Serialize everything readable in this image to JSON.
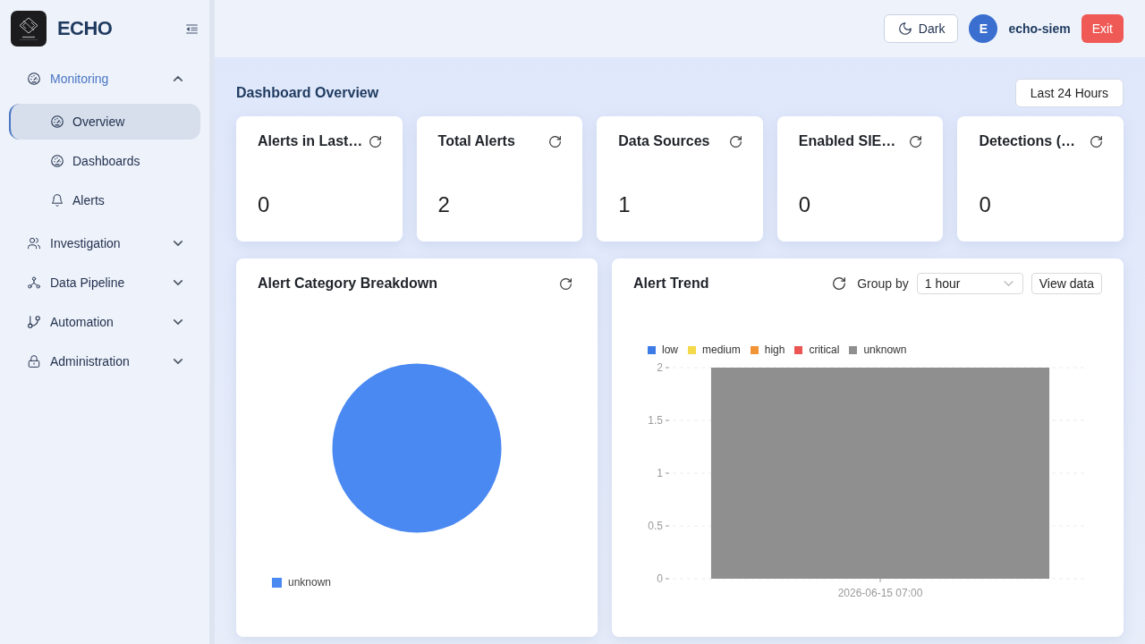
{
  "sidebar": {
    "brand": "ECHO",
    "nav": [
      {
        "label": "Monitoring",
        "selected": true,
        "expanded": true,
        "children": [
          {
            "label": "Overview",
            "selected": true
          },
          {
            "label": "Dashboards",
            "selected": false
          },
          {
            "label": "Alerts",
            "selected": false
          }
        ]
      },
      {
        "label": "Investigation",
        "selected": false,
        "expanded": false
      },
      {
        "label": "Data Pipeline",
        "selected": false,
        "expanded": false
      },
      {
        "label": "Automation",
        "selected": false,
        "expanded": false
      },
      {
        "label": "Administration",
        "selected": false,
        "expanded": false
      }
    ]
  },
  "header": {
    "theme_button": "Dark",
    "user": {
      "initial": "E",
      "name": "echo-siem"
    },
    "exit_button": "Exit"
  },
  "dashboard": {
    "title": "Dashboard Overview",
    "time_range_button": "Last 24 Hours",
    "stats": [
      {
        "title": "Alerts in Last…",
        "value": "0"
      },
      {
        "title": "Total Alerts",
        "value": "2"
      },
      {
        "title": "Data Sources",
        "value": "1"
      },
      {
        "title": "Enabled SIE…",
        "value": "0"
      },
      {
        "title": "Detections (…",
        "value": "0"
      }
    ],
    "category_breakdown": {
      "title": "Alert Category Breakdown",
      "chart_data": {
        "type": "pie",
        "categories": [
          "unknown"
        ],
        "values": [
          100
        ]
      }
    },
    "alert_trend": {
      "title": "Alert Trend",
      "group_by": {
        "label": "Group by",
        "value": "1 hour"
      },
      "view_data_button": "View data",
      "chart_data": {
        "type": "bar",
        "stacked": true,
        "grid": true,
        "categories": [
          "2026-06-15 07:00"
        ],
        "series": [
          {
            "name": "low",
            "color": "#3d7be6",
            "values": [
              0
            ]
          },
          {
            "name": "medium",
            "color": "#f4d94a",
            "values": [
              0
            ]
          },
          {
            "name": "high",
            "color": "#f09436",
            "values": [
              0
            ]
          },
          {
            "name": "critical",
            "color": "#eb5553",
            "values": [
              0
            ]
          },
          {
            "name": "unknown",
            "color": "#8f8f8f",
            "values": [
              2
            ]
          }
        ],
        "ylim": [
          0,
          2
        ],
        "yticks": [
          0,
          0.5,
          1,
          1.5,
          2
        ]
      }
    }
  }
}
